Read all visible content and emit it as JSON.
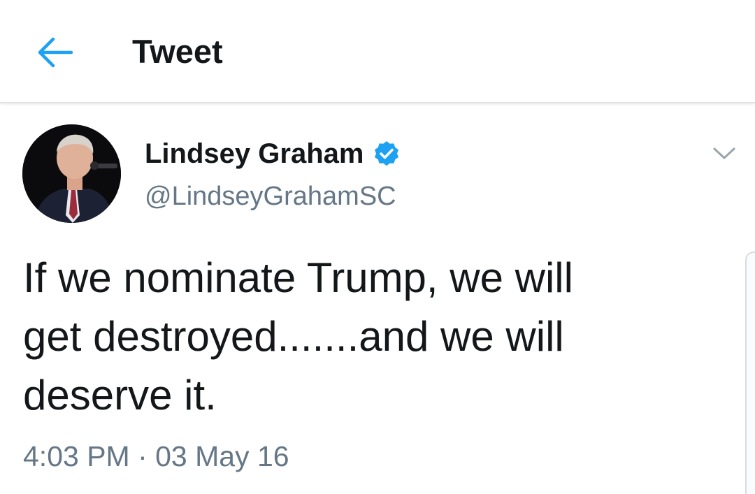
{
  "header": {
    "back_icon": "arrow-left-icon",
    "title": "Tweet"
  },
  "tweet": {
    "author": {
      "display_name": "Lindsey Graham",
      "handle": "@LindseyGrahamSC",
      "verified": true,
      "verified_icon": "verified-badge-icon"
    },
    "text": "If we nominate Trump, we will\nget destroyed.......and we will\ndeserve it.",
    "timestamp": "4:03 PM · 03 May 16",
    "menu_icon": "chevron-down-icon"
  },
  "colors": {
    "accent": "#1da1f2",
    "text_primary": "#14171a",
    "text_secondary": "#657786",
    "divider": "#dfe3e6"
  }
}
